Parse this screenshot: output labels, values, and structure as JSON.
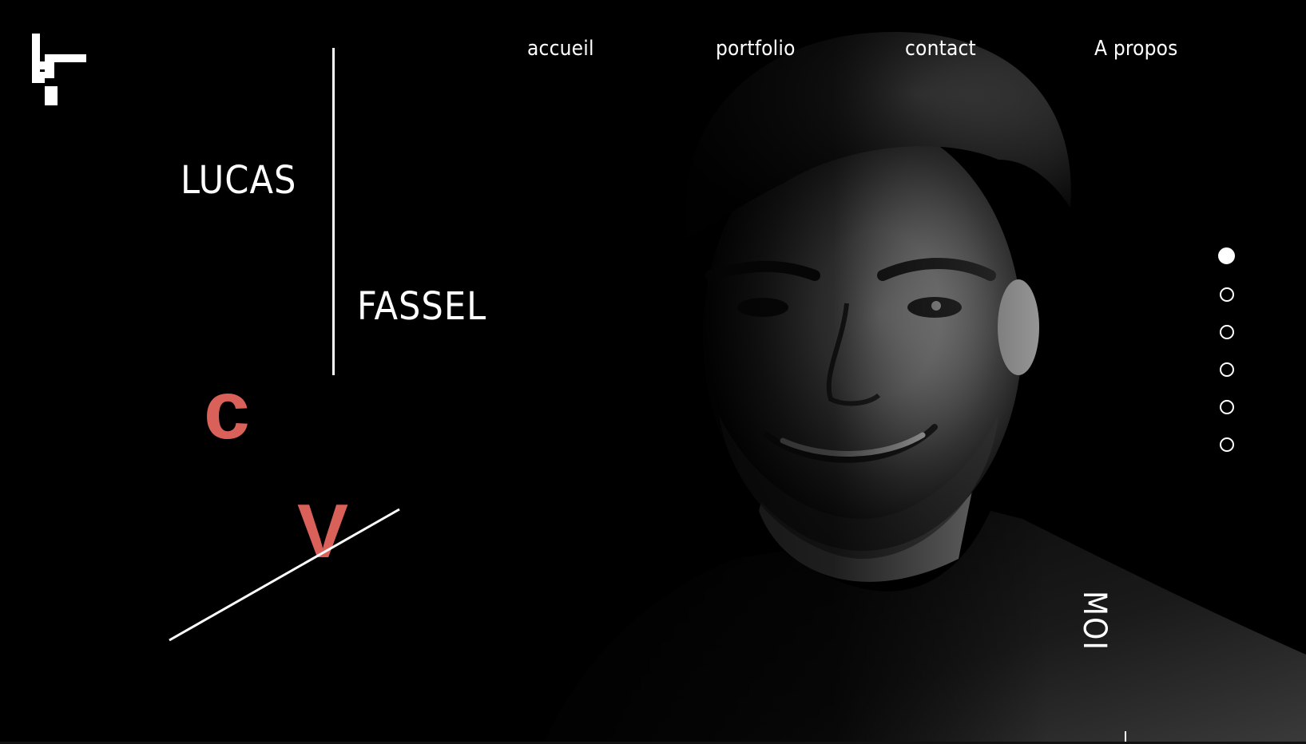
{
  "logo": {
    "icon": "lf-monogram-icon"
  },
  "nav": {
    "items": [
      {
        "label": "accueil"
      },
      {
        "label": "portfolio"
      },
      {
        "label": "contact"
      },
      {
        "label": "A propos"
      }
    ]
  },
  "hero": {
    "first_name": "LUCAS",
    "last_name": "FASSEL",
    "cv_letter_1": "c",
    "cv_letter_2": "v",
    "side_label": "MOI",
    "accent_color": "#d9615a"
  },
  "slider": {
    "dots_count": 6,
    "active_index": 0
  },
  "background": {
    "photo": "black-and-white portrait"
  }
}
